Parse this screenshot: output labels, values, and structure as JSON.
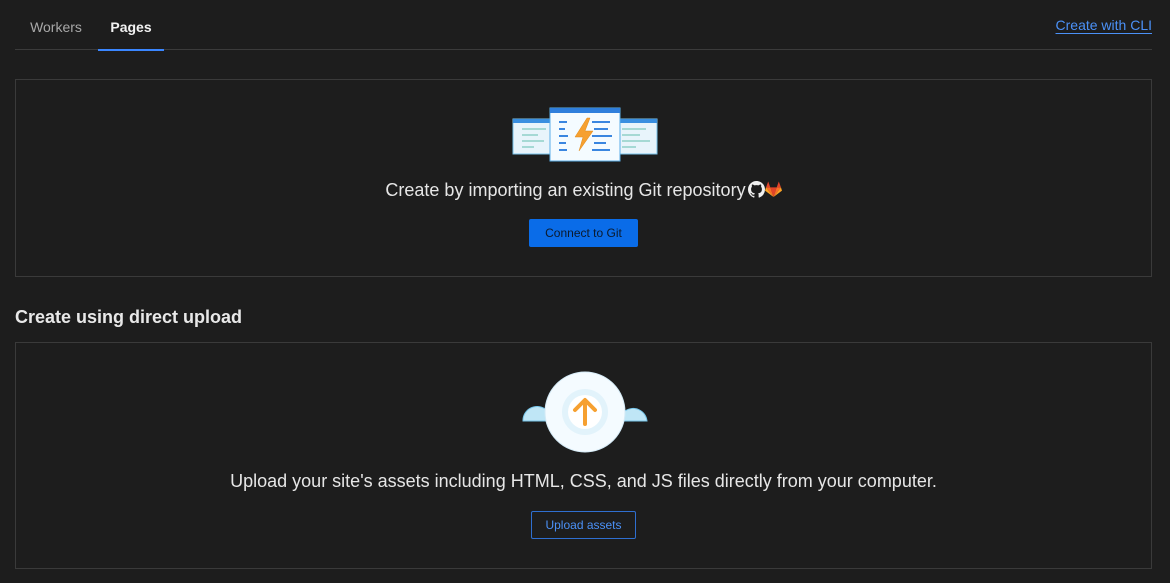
{
  "tabs": [
    {
      "label": "Workers",
      "active": false
    },
    {
      "label": "Pages",
      "active": true
    }
  ],
  "create_cli_link": "Create with CLI",
  "git_section": {
    "description": "Create by importing an existing Git repository",
    "icons": [
      "github-icon",
      "gitlab-icon"
    ],
    "button_label": "Connect to Git"
  },
  "upload_section": {
    "title": "Create using direct upload",
    "description": "Upload your site's assets including HTML, CSS, and JS files directly from your computer.",
    "button_label": "Upload assets"
  },
  "colors": {
    "background": "#1d1d1d",
    "accent": "#0a6ce8",
    "link": "#4b91f7",
    "orange": "#f6a030"
  }
}
